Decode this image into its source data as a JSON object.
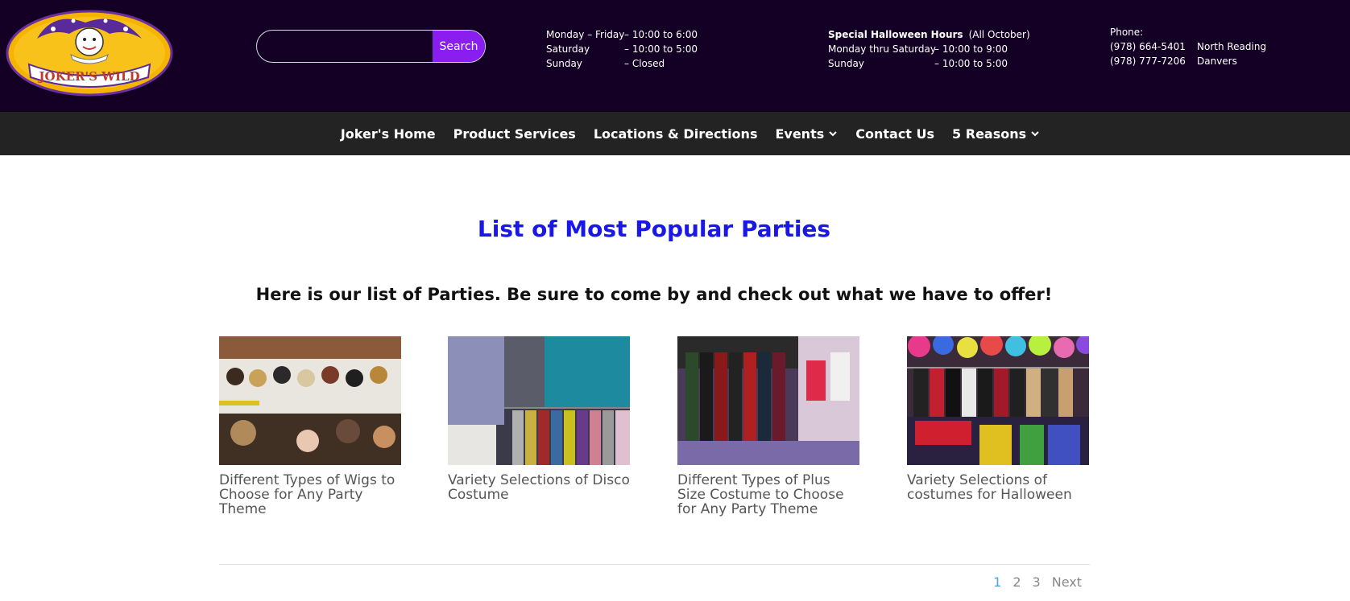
{
  "header": {
    "logo_text": "JOKER'S WILD",
    "search": {
      "placeholder": "",
      "value": "",
      "button_label": "Search"
    },
    "hours": [
      {
        "day": "Monday – Friday",
        "time": "– 10:00 to 6:00"
      },
      {
        "day": "Saturday",
        "time": "– 10:00 to 5:00"
      },
      {
        "day": "Sunday",
        "time": "– Closed"
      }
    ],
    "halloween": {
      "title": "Special Halloween Hours",
      "note": "(All October)",
      "rows": [
        {
          "day": "Monday thru Saturday",
          "time": "– 10:00 to 9:00"
        },
        {
          "day": "Sunday",
          "time": "– 10:00 to 5:00"
        }
      ]
    },
    "phone": {
      "label": "Phone:",
      "rows": [
        {
          "number": "(978) 664-5401",
          "location": "North Reading"
        },
        {
          "number": "(978) 777-7206",
          "location": "Danvers"
        }
      ]
    }
  },
  "nav": [
    {
      "label": "Joker's Home",
      "dropdown": false
    },
    {
      "label": "Product Services",
      "dropdown": false
    },
    {
      "label": "Locations & Directions",
      "dropdown": false
    },
    {
      "label": "Events",
      "dropdown": true
    },
    {
      "label": "Contact Us",
      "dropdown": false
    },
    {
      "label": "5 Reasons",
      "dropdown": true
    }
  ],
  "main": {
    "title": "List of Most Popular Parties",
    "subtitle": "Here is our list of Parties. Be sure to come by and check out what we have to offer!",
    "cards": [
      {
        "caption": "Different Types of Wigs to Choose for Any Party Theme"
      },
      {
        "caption": "Variety Selections of Disco Costume"
      },
      {
        "caption": "Different Types of Plus Size Costume to Choose for Any Party Theme"
      },
      {
        "caption": "Variety Selections of costumes for Halloween"
      }
    ],
    "pagination": {
      "pages": [
        "1",
        "2",
        "3"
      ],
      "current": "1",
      "next": "Next"
    }
  },
  "colors": {
    "header_bg": "#130024",
    "nav_bg": "#232323",
    "search_button": "#8a1ef0",
    "title": "#1a18e6",
    "pagination_active": "#4aa3df"
  }
}
